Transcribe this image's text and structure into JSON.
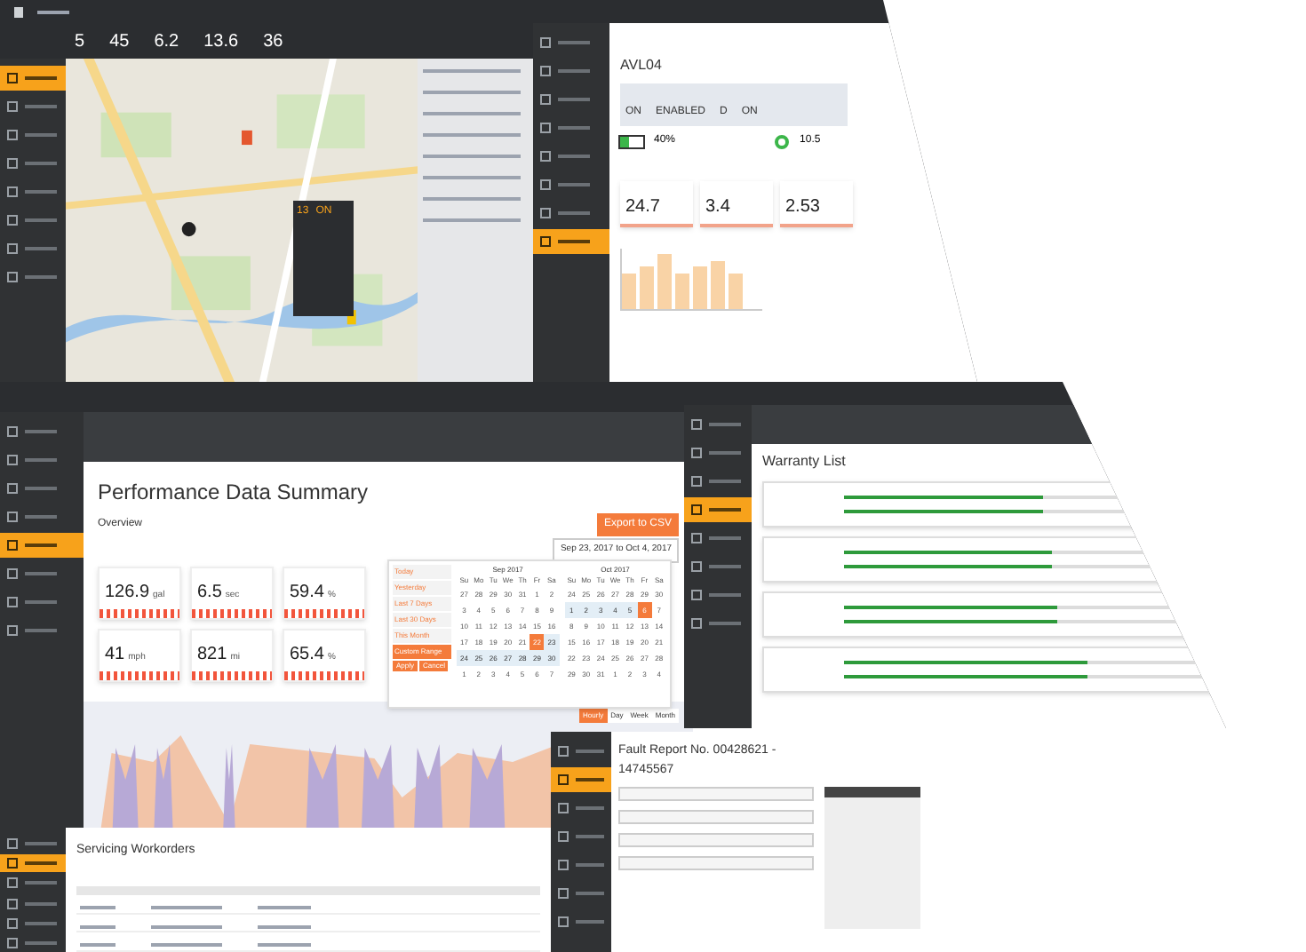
{
  "map_window": {
    "stats": [
      {
        "value": "5"
      },
      {
        "value": "45"
      },
      {
        "value": "6.2"
      },
      {
        "value": "13.6"
      },
      {
        "value": "36"
      }
    ],
    "nav": [
      {
        "selected": true
      },
      {
        "selected": false
      },
      {
        "selected": false
      },
      {
        "selected": false
      },
      {
        "selected": false
      },
      {
        "selected": false
      },
      {
        "selected": false
      },
      {
        "selected": false
      }
    ],
    "popup": {
      "speed": "13",
      "status": "ON"
    }
  },
  "vehicle_window": {
    "title": "AVL04",
    "status": [
      {
        "value": "ON"
      },
      {
        "value": "ENABLED"
      },
      {
        "value": "D"
      },
      {
        "value": "ON"
      }
    ],
    "battery": {
      "level": 0.4,
      "reading": "40%"
    },
    "gauge_reading": "10.5",
    "tiles": [
      {
        "value": "24.7"
      },
      {
        "value": "3.4"
      },
      {
        "value": "2.53"
      }
    ],
    "nav": [
      {
        "selected": false
      },
      {
        "selected": false
      },
      {
        "selected": false
      },
      {
        "selected": false
      },
      {
        "selected": false
      },
      {
        "selected": false
      },
      {
        "selected": false
      },
      {
        "selected": true
      }
    ]
  },
  "performance_window": {
    "title": "Performance Data Summary",
    "section": "Overview",
    "export_button": "Export to CSV",
    "date_range": "Sep 23, 2017 to Oct 4, 2017",
    "nav": [
      {
        "selected": false
      },
      {
        "selected": false
      },
      {
        "selected": false
      },
      {
        "selected": false
      },
      {
        "selected": true
      },
      {
        "selected": false
      },
      {
        "selected": false
      },
      {
        "selected": false
      }
    ],
    "kpis": [
      {
        "value": "126.9",
        "unit": "gal"
      },
      {
        "value": "6.5",
        "unit": "sec"
      },
      {
        "value": "59.4",
        "unit": "%"
      },
      {
        "value": "41",
        "unit": "mph"
      },
      {
        "value": "821",
        "unit": "mi"
      },
      {
        "value": "65.4",
        "unit": "%"
      }
    ],
    "presets": [
      {
        "label": "Today",
        "selected": false
      },
      {
        "label": "Yesterday",
        "selected": false
      },
      {
        "label": "Last 7 Days",
        "selected": false
      },
      {
        "label": "Last 30 Days",
        "selected": false
      },
      {
        "label": "This Month",
        "selected": false
      },
      {
        "label": "Custom Range",
        "selected": true
      }
    ],
    "apply_button": "Apply",
    "cancel_button": "Cancel",
    "months": [
      {
        "title": "Sep 2017",
        "weekdays": [
          "Su",
          "Mo",
          "Tu",
          "We",
          "Th",
          "Fr",
          "Sa"
        ],
        "days": [
          {
            "label": "27",
            "selected": false,
            "in_range": false
          },
          {
            "label": "28",
            "selected": false,
            "in_range": false
          },
          {
            "label": "29",
            "selected": false,
            "in_range": false
          },
          {
            "label": "30",
            "selected": false,
            "in_range": false
          },
          {
            "label": "31",
            "selected": false,
            "in_range": false
          },
          {
            "label": "1",
            "selected": false,
            "in_range": false
          },
          {
            "label": "2",
            "selected": false,
            "in_range": false
          },
          {
            "label": "3",
            "selected": false,
            "in_range": false
          },
          {
            "label": "4",
            "selected": false,
            "in_range": false
          },
          {
            "label": "5",
            "selected": false,
            "in_range": false
          },
          {
            "label": "6",
            "selected": false,
            "in_range": false
          },
          {
            "label": "7",
            "selected": false,
            "in_range": false
          },
          {
            "label": "8",
            "selected": false,
            "in_range": false
          },
          {
            "label": "9",
            "selected": false,
            "in_range": false
          },
          {
            "label": "10",
            "selected": false,
            "in_range": false
          },
          {
            "label": "11",
            "selected": false,
            "in_range": false
          },
          {
            "label": "12",
            "selected": false,
            "in_range": false
          },
          {
            "label": "13",
            "selected": false,
            "in_range": false
          },
          {
            "label": "14",
            "selected": false,
            "in_range": false
          },
          {
            "label": "15",
            "selected": false,
            "in_range": false
          },
          {
            "label": "16",
            "selected": false,
            "in_range": false
          },
          {
            "label": "17",
            "selected": false,
            "in_range": false
          },
          {
            "label": "18",
            "selected": false,
            "in_range": false
          },
          {
            "label": "19",
            "selected": false,
            "in_range": false
          },
          {
            "label": "20",
            "selected": false,
            "in_range": false
          },
          {
            "label": "21",
            "selected": false,
            "in_range": false
          },
          {
            "label": "22",
            "selected": true,
            "in_range": false
          },
          {
            "label": "23",
            "selected": false,
            "in_range": true
          },
          {
            "label": "24",
            "selected": false,
            "in_range": true
          },
          {
            "label": "25",
            "selected": false,
            "in_range": true
          },
          {
            "label": "26",
            "selected": false,
            "in_range": true
          },
          {
            "label": "27",
            "selected": false,
            "in_range": true
          },
          {
            "label": "28",
            "selected": false,
            "in_range": true
          },
          {
            "label": "29",
            "selected": false,
            "in_range": true
          },
          {
            "label": "30",
            "selected": false,
            "in_range": true
          },
          {
            "label": "1",
            "selected": false,
            "in_range": false
          },
          {
            "label": "2",
            "selected": false,
            "in_range": false
          },
          {
            "label": "3",
            "selected": false,
            "in_range": false
          },
          {
            "label": "4",
            "selected": false,
            "in_range": false
          },
          {
            "label": "5",
            "selected": false,
            "in_range": false
          },
          {
            "label": "6",
            "selected": false,
            "in_range": false
          },
          {
            "label": "7",
            "selected": false,
            "in_range": false
          }
        ]
      },
      {
        "title": "Oct 2017",
        "weekdays": [
          "Su",
          "Mo",
          "Tu",
          "We",
          "Th",
          "Fr",
          "Sa"
        ],
        "days": [
          {
            "label": "24",
            "selected": false,
            "in_range": false
          },
          {
            "label": "25",
            "selected": false,
            "in_range": false
          },
          {
            "label": "26",
            "selected": false,
            "in_range": false
          },
          {
            "label": "27",
            "selected": false,
            "in_range": false
          },
          {
            "label": "28",
            "selected": false,
            "in_range": false
          },
          {
            "label": "29",
            "selected": false,
            "in_range": false
          },
          {
            "label": "30",
            "selected": false,
            "in_range": false
          },
          {
            "label": "1",
            "selected": false,
            "in_range": true
          },
          {
            "label": "2",
            "selected": false,
            "in_range": true
          },
          {
            "label": "3",
            "selected": false,
            "in_range": true
          },
          {
            "label": "4",
            "selected": false,
            "in_range": true
          },
          {
            "label": "5",
            "selected": false,
            "in_range": true
          },
          {
            "label": "6",
            "selected": true,
            "in_range": false
          },
          {
            "label": "7",
            "selected": false,
            "in_range": false
          },
          {
            "label": "8",
            "selected": false,
            "in_range": false
          },
          {
            "label": "9",
            "selected": false,
            "in_range": false
          },
          {
            "label": "10",
            "selected": false,
            "in_range": false
          },
          {
            "label": "11",
            "selected": false,
            "in_range": false
          },
          {
            "label": "12",
            "selected": false,
            "in_range": false
          },
          {
            "label": "13",
            "selected": false,
            "in_range": false
          },
          {
            "label": "14",
            "selected": false,
            "in_range": false
          },
          {
            "label": "15",
            "selected": false,
            "in_range": false
          },
          {
            "label": "16",
            "selected": false,
            "in_range": false
          },
          {
            "label": "17",
            "selected": false,
            "in_range": false
          },
          {
            "label": "18",
            "selected": false,
            "in_range": false
          },
          {
            "label": "19",
            "selected": false,
            "in_range": false
          },
          {
            "label": "20",
            "selected": false,
            "in_range": false
          },
          {
            "label": "21",
            "selected": false,
            "in_range": false
          },
          {
            "label": "22",
            "selected": false,
            "in_range": false
          },
          {
            "label": "23",
            "selected": false,
            "in_range": false
          },
          {
            "label": "24",
            "selected": false,
            "in_range": false
          },
          {
            "label": "25",
            "selected": false,
            "in_range": false
          },
          {
            "label": "26",
            "selected": false,
            "in_range": false
          },
          {
            "label": "27",
            "selected": false,
            "in_range": false
          },
          {
            "label": "28",
            "selected": false,
            "in_range": false
          },
          {
            "label": "29",
            "selected": false,
            "in_range": false
          },
          {
            "label": "30",
            "selected": false,
            "in_range": false
          },
          {
            "label": "31",
            "selected": false,
            "in_range": false
          },
          {
            "label": "1",
            "selected": false,
            "in_range": false
          },
          {
            "label": "2",
            "selected": false,
            "in_range": false
          },
          {
            "label": "3",
            "selected": false,
            "in_range": false
          },
          {
            "label": "4",
            "selected": false,
            "in_range": false
          }
        ]
      }
    ],
    "chart_tabs": [
      {
        "label": "Hourly",
        "selected": true
      },
      {
        "label": "Day",
        "selected": false
      },
      {
        "label": "Week",
        "selected": false
      },
      {
        "label": "Month",
        "selected": false
      }
    ]
  },
  "warranty_window": {
    "title": "Warranty List",
    "nav": [
      {
        "selected": false
      },
      {
        "selected": false
      },
      {
        "selected": false
      },
      {
        "selected": true
      },
      {
        "selected": false
      },
      {
        "selected": false
      },
      {
        "selected": false
      },
      {
        "selected": false
      }
    ],
    "cards": [
      {
        "bars": [
          {
            "level": 0.45
          },
          {
            "level": 0.45
          }
        ]
      },
      {
        "bars": [
          {
            "level": 0.47
          },
          {
            "level": 0.47
          }
        ]
      },
      {
        "bars": [
          {
            "level": 0.48
          },
          {
            "level": 0.48
          }
        ]
      },
      {
        "bars": [
          {
            "level": 0.55
          },
          {
            "level": 0.55
          }
        ]
      }
    ]
  },
  "fault_window": {
    "title": "Fault Report No. 00428621 - 14745567",
    "nav": [
      {
        "selected": false
      },
      {
        "selected": true
      },
      {
        "selected": false
      },
      {
        "selected": false
      },
      {
        "selected": false
      },
      {
        "selected": false
      },
      {
        "selected": false
      }
    ]
  },
  "workorders_window": {
    "title": "Servicing Workorders",
    "nav": [
      {
        "selected": false
      },
      {
        "selected": true
      },
      {
        "selected": false
      },
      {
        "selected": false
      },
      {
        "selected": false
      },
      {
        "selected": false
      }
    ]
  }
}
